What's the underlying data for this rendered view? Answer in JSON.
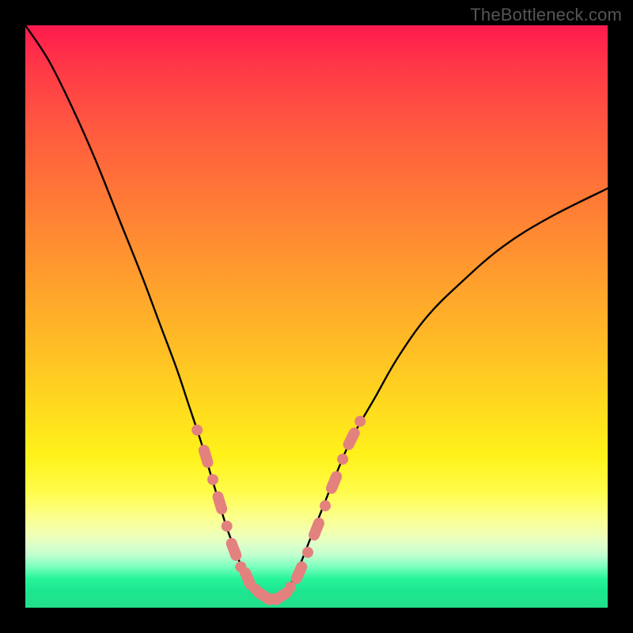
{
  "watermark_text": "TheBottleneck.com",
  "colors": {
    "curve_stroke": "#000000",
    "marker_fill": "#e3817f",
    "frame_bg": "#000000"
  },
  "chart_data": {
    "type": "line",
    "title": "",
    "xlabel": "",
    "ylabel": "",
    "xlim": [
      0,
      100
    ],
    "ylim": [
      0,
      100
    ],
    "series": [
      {
        "name": "left-curve",
        "x": [
          0,
          4,
          8,
          12,
          16,
          20,
          23,
          26,
          28,
          30,
          31.5,
          33,
          34.5,
          36,
          37.5,
          39
        ],
        "y": [
          100,
          94,
          86,
          77,
          67,
          57,
          49,
          41,
          35,
          29,
          24,
          19,
          14,
          10,
          6,
          3
        ]
      },
      {
        "name": "valley-floor",
        "x": [
          39,
          40.5,
          42,
          43.5,
          45
        ],
        "y": [
          3,
          1.5,
          1,
          1.5,
          3
        ]
      },
      {
        "name": "right-curve",
        "x": [
          45,
          47,
          49,
          51,
          53,
          56,
          60,
          64,
          69,
          75,
          82,
          90,
          100
        ],
        "y": [
          3,
          7,
          12,
          17,
          22,
          29,
          36,
          43,
          50,
          56,
          62,
          67,
          72
        ]
      }
    ],
    "markers": [
      {
        "x": 29.5,
        "y": 30.5,
        "shape": "dot"
      },
      {
        "x": 31.0,
        "y": 26.0,
        "shape": "pill"
      },
      {
        "x": 32.2,
        "y": 22.0,
        "shape": "dot"
      },
      {
        "x": 33.4,
        "y": 18.0,
        "shape": "pill"
      },
      {
        "x": 34.6,
        "y": 14.0,
        "shape": "dot"
      },
      {
        "x": 35.8,
        "y": 10.0,
        "shape": "pill"
      },
      {
        "x": 37.0,
        "y": 7.0,
        "shape": "dot"
      },
      {
        "x": 38.2,
        "y": 5.0,
        "shape": "pill"
      },
      {
        "x": 39.5,
        "y": 3.2,
        "shape": "dot"
      },
      {
        "x": 41.0,
        "y": 2.0,
        "shape": "pill"
      },
      {
        "x": 42.5,
        "y": 1.5,
        "shape": "dot"
      },
      {
        "x": 44.0,
        "y": 2.0,
        "shape": "pill"
      },
      {
        "x": 45.5,
        "y": 3.5,
        "shape": "dot"
      },
      {
        "x": 47.0,
        "y": 6.0,
        "shape": "pill"
      },
      {
        "x": 48.5,
        "y": 9.5,
        "shape": "dot"
      },
      {
        "x": 50.0,
        "y": 13.5,
        "shape": "pill"
      },
      {
        "x": 51.5,
        "y": 17.5,
        "shape": "dot"
      },
      {
        "x": 53.0,
        "y": 21.5,
        "shape": "pill"
      },
      {
        "x": 54.5,
        "y": 25.5,
        "shape": "dot"
      },
      {
        "x": 56.0,
        "y": 29.0,
        "shape": "pill"
      },
      {
        "x": 57.5,
        "y": 32.0,
        "shape": "dot"
      }
    ]
  }
}
